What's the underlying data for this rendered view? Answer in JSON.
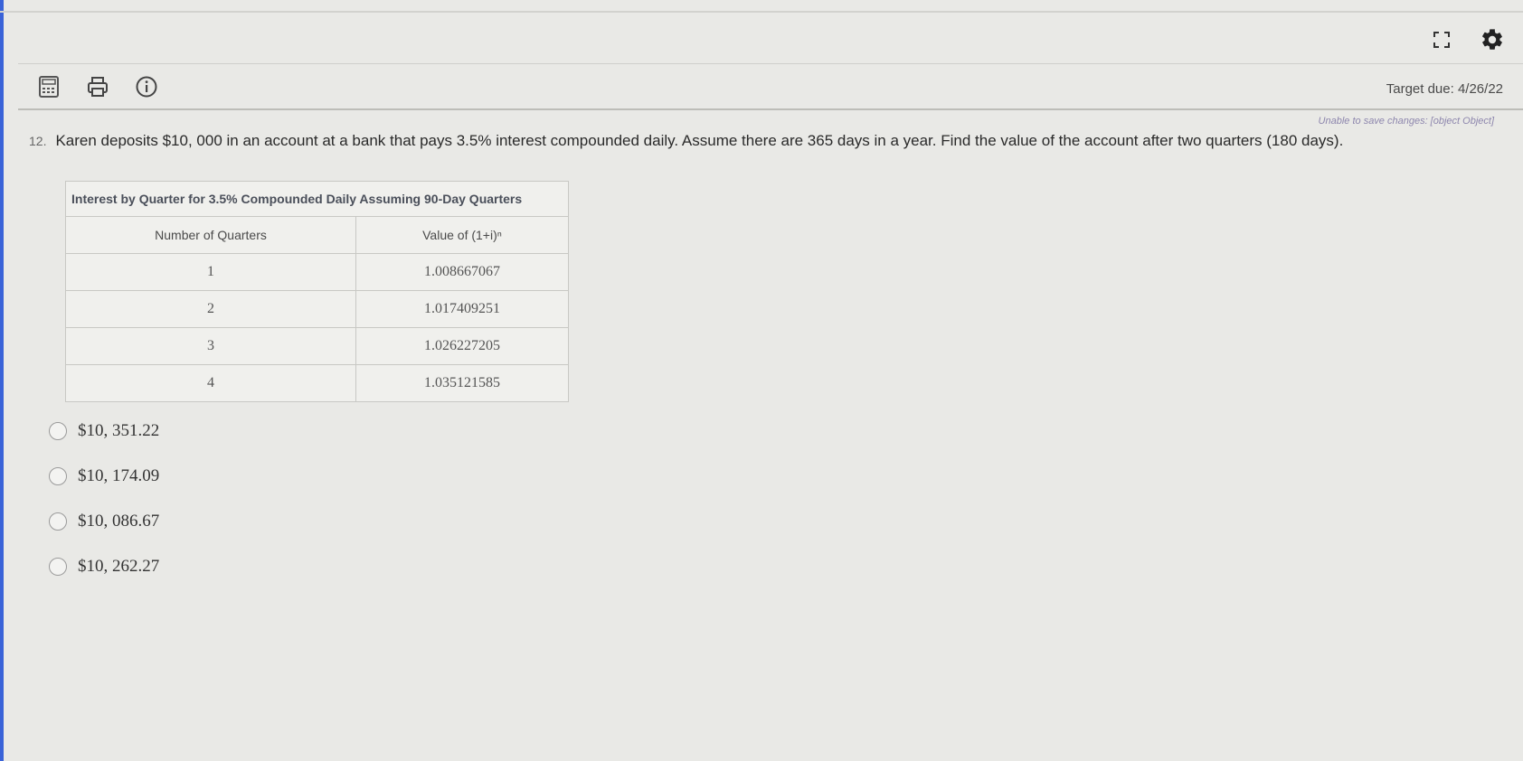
{
  "toolbar": {
    "icons": [
      "calculator-icon",
      "print-icon",
      "info-icon"
    ]
  },
  "top_icons": [
    "fullscreen-icon",
    "gear-icon"
  ],
  "header": {
    "target_due": "Target due: 4/26/22",
    "save_warning": "Unable to save changes: [object Object]"
  },
  "question": {
    "number": "12.",
    "text": "Karen deposits $10, 000 in an account at a bank that pays 3.5% interest compounded daily. Assume there are 365 days in a year. Find the value of the account after two quarters (180 days)."
  },
  "table": {
    "caption": "Interest by Quarter for 3.5% Compounded Daily Assuming 90-Day Quarters",
    "headers": [
      "Number of Quarters",
      "Value of (1+i)ⁿ"
    ],
    "rows": [
      [
        "1",
        "1.008667067"
      ],
      [
        "2",
        "1.017409251"
      ],
      [
        "3",
        "1.026227205"
      ],
      [
        "4",
        "1.035121585"
      ]
    ]
  },
  "options": [
    {
      "label": "$10, 351.22",
      "selected": false
    },
    {
      "label": "$10, 174.09",
      "selected": false
    },
    {
      "label": "$10, 086.67",
      "selected": false
    },
    {
      "label": "$10, 262.27",
      "selected": false
    }
  ]
}
